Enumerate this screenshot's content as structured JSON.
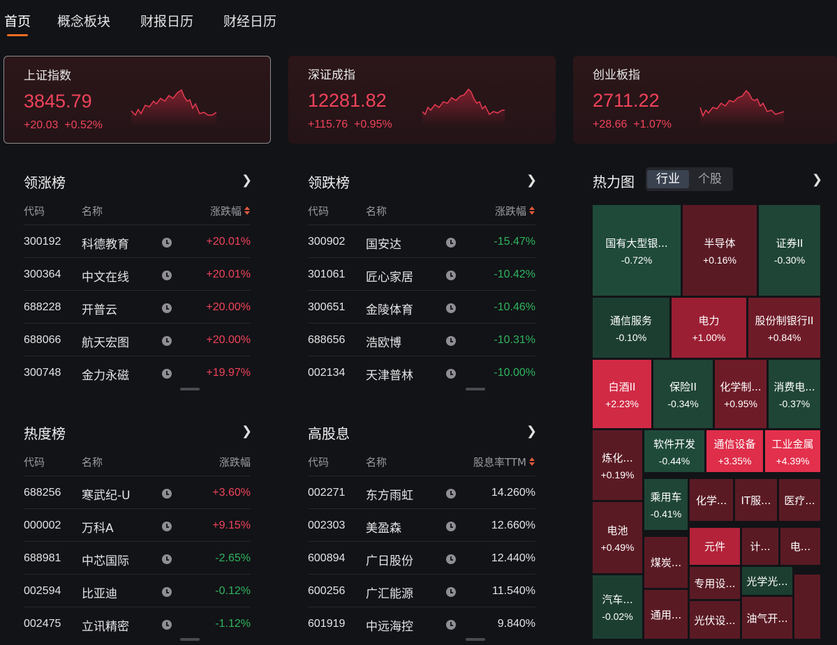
{
  "nav": {
    "tabs": [
      {
        "label": "首页"
      },
      {
        "label": "概念板块"
      },
      {
        "label": "财报日历"
      },
      {
        "label": "财经日历"
      }
    ]
  },
  "indices": [
    {
      "name": "上证指数",
      "value": "3845.79",
      "change": "+20.03",
      "pct": "+0.52%"
    },
    {
      "name": "深证成指",
      "value": "12281.82",
      "change": "+115.76",
      "pct": "+0.95%"
    },
    {
      "name": "创业板指",
      "value": "2711.22",
      "change": "+28.66",
      "pct": "+1.07%"
    }
  ],
  "gainers": {
    "title": "领涨榜",
    "headers": {
      "code": "代码",
      "name": "名称",
      "value": "涨跌幅"
    },
    "rows": [
      {
        "code": "300192",
        "name": "科德教育",
        "value": "+20.01%",
        "dir": "up"
      },
      {
        "code": "300364",
        "name": "中文在线",
        "value": "+20.01%",
        "dir": "up"
      },
      {
        "code": "688228",
        "name": "开普云",
        "value": "+20.00%",
        "dir": "up"
      },
      {
        "code": "688066",
        "name": "航天宏图",
        "value": "+20.00%",
        "dir": "up"
      },
      {
        "code": "300748",
        "name": "金力永磁",
        "value": "+19.97%",
        "dir": "up"
      }
    ]
  },
  "losers": {
    "title": "领跌榜",
    "headers": {
      "code": "代码",
      "name": "名称",
      "value": "涨跌幅"
    },
    "rows": [
      {
        "code": "300902",
        "name": "国安达",
        "value": "-15.47%",
        "dir": "down"
      },
      {
        "code": "301061",
        "name": "匠心家居",
        "value": "-10.42%",
        "dir": "down"
      },
      {
        "code": "300651",
        "name": "金陵体育",
        "value": "-10.46%",
        "dir": "down"
      },
      {
        "code": "688656",
        "name": "浩欧博",
        "value": "-10.31%",
        "dir": "down"
      },
      {
        "code": "002134",
        "name": "天津普林",
        "value": "-10.00%",
        "dir": "down"
      }
    ]
  },
  "hot": {
    "title": "热度榜",
    "headers": {
      "code": "代码",
      "name": "名称",
      "value": "涨跌幅"
    },
    "rows": [
      {
        "code": "688256",
        "name": "寒武纪-U",
        "value": "+3.60%",
        "dir": "up"
      },
      {
        "code": "000002",
        "name": "万科A",
        "value": "+9.15%",
        "dir": "up"
      },
      {
        "code": "688981",
        "name": "中芯国际",
        "value": "-2.65%",
        "dir": "down"
      },
      {
        "code": "002594",
        "name": "比亚迪",
        "value": "-0.12%",
        "dir": "down"
      },
      {
        "code": "002475",
        "name": "立讯精密",
        "value": "-1.12%",
        "dir": "down"
      }
    ]
  },
  "dividend": {
    "title": "高股息",
    "headers": {
      "code": "代码",
      "name": "名称",
      "value": "股息率TTM"
    },
    "rows": [
      {
        "code": "002271",
        "name": "东方雨虹",
        "value": "14.260%",
        "dir": "flat"
      },
      {
        "code": "002303",
        "name": "美盈森",
        "value": "12.660%",
        "dir": "flat"
      },
      {
        "code": "600894",
        "name": "广日股份",
        "value": "12.440%",
        "dir": "flat"
      },
      {
        "code": "600256",
        "name": "广汇能源",
        "value": "11.540%",
        "dir": "flat"
      },
      {
        "code": "601919",
        "name": "中远海控",
        "value": "9.840%",
        "dir": "flat"
      }
    ]
  },
  "heatmap": {
    "title": "热力图",
    "toggle": {
      "industry": "行业",
      "stock": "个股"
    },
    "tiles": [
      {
        "name": "国有大型银...",
        "value": "-0.72%",
        "color": "#1f4a3a"
      },
      {
        "name": "半导体",
        "value": "+0.16%",
        "color": "#5a1a24"
      },
      {
        "name": "证券II",
        "value": "-0.30%",
        "color": "#1f4536"
      },
      {
        "name": "通信服务",
        "value": "-0.10%",
        "color": "#1c3e31"
      },
      {
        "name": "电力",
        "value": "+1.00%",
        "color": "#9b1f33"
      },
      {
        "name": "股份制银行II",
        "value": "+0.84%",
        "color": "#6e1b28"
      },
      {
        "name": "白酒II",
        "value": "+2.23%",
        "color": "#d12a45"
      },
      {
        "name": "保险II",
        "value": "-0.34%",
        "color": "#1f4536"
      },
      {
        "name": "化学制...",
        "value": "+0.95%",
        "color": "#6e1b28"
      },
      {
        "name": "消费电...",
        "value": "-0.37%",
        "color": "#1f4536"
      },
      {
        "name": "炼化...",
        "value": "+0.19%",
        "color": "#5a1a24"
      },
      {
        "name": "软件开发",
        "value": "-0.44%",
        "color": "#1f4a3a"
      },
      {
        "name": "通信设备",
        "value": "+3.35%",
        "color": "#de2e4a"
      },
      {
        "name": "工业金属",
        "value": "+4.39%",
        "color": "#e3304c"
      },
      {
        "name": "乘用车",
        "value": "-0.41%",
        "color": "#1f4536"
      },
      {
        "name": "化学...",
        "value": "",
        "color": "#5a1a24"
      },
      {
        "name": "IT服...",
        "value": "",
        "color": "#5a1a24"
      },
      {
        "name": "医疗...",
        "value": "",
        "color": "#5a1a24"
      },
      {
        "name": "电池",
        "value": "+0.49%",
        "color": "#5a1a24"
      },
      {
        "name": "煤炭...",
        "value": "",
        "color": "#5a1a24"
      },
      {
        "name": "元件",
        "value": "",
        "color": "#b32238"
      },
      {
        "name": "计...",
        "value": "",
        "color": "#5a1a24"
      },
      {
        "name": "电...",
        "value": "",
        "color": "#5a1a24"
      },
      {
        "name": "专用设...",
        "value": "",
        "color": "#5a1a24"
      },
      {
        "name": "光学光...",
        "value": "",
        "color": "#1c3e31"
      },
      {
        "name": "汽车...",
        "value": "-0.02%",
        "color": "#1c3e31"
      },
      {
        "name": "通用...",
        "value": "",
        "color": "#5a1a24"
      },
      {
        "name": "光伏设...",
        "value": "",
        "color": "#5a1a24"
      },
      {
        "name": "油气开...",
        "value": "",
        "color": "#5a1a24"
      },
      {
        "name": "",
        "value": "",
        "color": "#5a1a24"
      }
    ]
  },
  "colors": {
    "up": "#f0435a",
    "down": "#2fb45e",
    "accent": "#f26d21"
  },
  "icons": {
    "row_icon": "clock-icon",
    "panel_more": "chevron-right-icon",
    "sort": "sort-icon"
  }
}
